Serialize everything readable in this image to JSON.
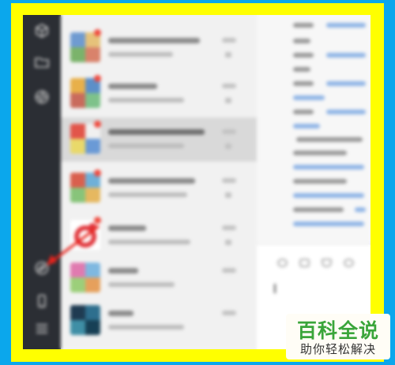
{
  "colors": {
    "background": "#0ba7ec",
    "frame": "#ffff00",
    "sidebar": "#2b2e34",
    "chat_list": "#f1f1f1",
    "selected_chat": "#d9d9d9",
    "unread_badge": "#f04a3e",
    "annotation_arrow": "#e8231c",
    "link_text": "#8fb4e6",
    "watermark_green": "#3aa53a"
  },
  "sidebar": {
    "top_icons": [
      "mini-program-cube-icon",
      "folder-icon",
      "moments-aperture-icon"
    ],
    "bottom_icons": [
      "link-icon",
      "phone-icon",
      "menu-icon"
    ],
    "highlighted": "link-icon"
  },
  "chat_list": {
    "count": 7,
    "selected_index": 2,
    "unread_indices": [
      0,
      1,
      2,
      3,
      4
    ]
  },
  "annotation": {
    "type": "arrow",
    "points_to": "link-icon"
  },
  "watermark": {
    "line1": "百科全说",
    "line2": "助你轻松解决"
  }
}
